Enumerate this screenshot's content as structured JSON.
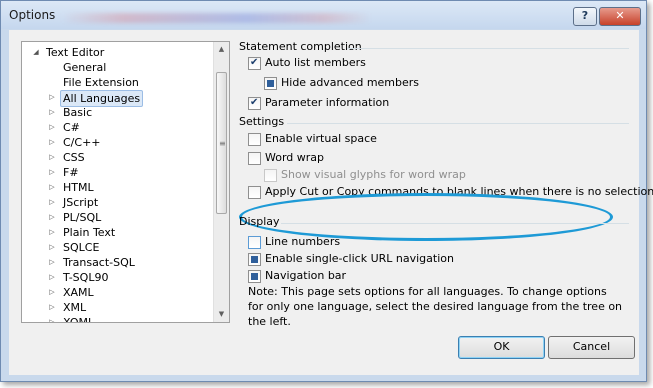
{
  "window": {
    "title": "Options",
    "help_label": "?",
    "close_label": "✕"
  },
  "tree": {
    "collapse_glyph": "◢",
    "expand_glyph": "▷",
    "items": [
      {
        "label": "Text Editor",
        "level": 0,
        "expander": "collapse"
      },
      {
        "label": "General",
        "level": 1,
        "expander": "none"
      },
      {
        "label": "File Extension",
        "level": 1,
        "expander": "none"
      },
      {
        "label": "All Languages",
        "level": 1,
        "expander": "expand",
        "selected": true
      },
      {
        "label": "Basic",
        "level": 1,
        "expander": "expand"
      },
      {
        "label": "C#",
        "level": 1,
        "expander": "expand"
      },
      {
        "label": "C/C++",
        "level": 1,
        "expander": "expand"
      },
      {
        "label": "CSS",
        "level": 1,
        "expander": "expand"
      },
      {
        "label": "F#",
        "level": 1,
        "expander": "expand"
      },
      {
        "label": "HTML",
        "level": 1,
        "expander": "expand"
      },
      {
        "label": "JScript",
        "level": 1,
        "expander": "expand"
      },
      {
        "label": "PL/SQL",
        "level": 1,
        "expander": "expand"
      },
      {
        "label": "Plain Text",
        "level": 1,
        "expander": "expand"
      },
      {
        "label": "SQLCE",
        "level": 1,
        "expander": "expand"
      },
      {
        "label": "Transact-SQL",
        "level": 1,
        "expander": "expand"
      },
      {
        "label": "T-SQL90",
        "level": 1,
        "expander": "expand"
      },
      {
        "label": "XAML",
        "level": 1,
        "expander": "expand"
      },
      {
        "label": "XML",
        "level": 1,
        "expander": "expand"
      },
      {
        "label": "XOML",
        "level": 1,
        "expander": "expand"
      }
    ]
  },
  "scrollbar": {
    "up_arrow": "▲",
    "down_arrow": "▼",
    "grip": "≡"
  },
  "sections": {
    "statement_completion": "Statement completion",
    "settings": "Settings",
    "display": "Display"
  },
  "options": {
    "auto_list_members": {
      "label": "Auto list members",
      "state": "checked"
    },
    "hide_advanced_members": {
      "label": "Hide advanced members",
      "state": "partial"
    },
    "parameter_information": {
      "label": "Parameter information",
      "state": "checked"
    },
    "enable_virtual_space": {
      "label": "Enable virtual space",
      "state": "unchecked"
    },
    "word_wrap": {
      "label": "Word wrap",
      "state": "unchecked"
    },
    "show_visual_glyphs": {
      "label": "Show visual glyphs for word wrap",
      "state": "disabled"
    },
    "apply_cut_copy": {
      "label": "Apply Cut or Copy commands to blank lines when there is no selection",
      "state": "unchecked"
    },
    "line_numbers": {
      "label": "Line numbers",
      "state": "unchecked"
    },
    "single_click_url": {
      "label": "Enable single-click URL navigation",
      "state": "partial"
    },
    "navigation_bar": {
      "label": "Navigation bar",
      "state": "partial"
    }
  },
  "note": "Note: This page sets options for all languages. To change options for only one language, select the desired language from the tree on the left.",
  "buttons": {
    "ok": "OK",
    "cancel": "Cancel"
  },
  "colors": {
    "highlight_ellipse": "#1e9ad6",
    "selection": "#dbe8f7",
    "title_bar": "#c9d9ec"
  }
}
